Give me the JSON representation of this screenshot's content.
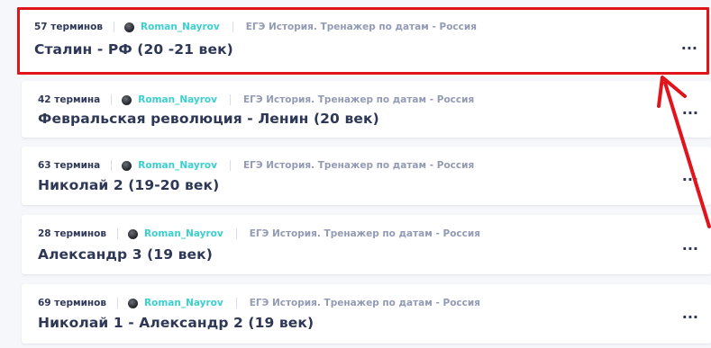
{
  "sets": [
    {
      "count": "57 терминов",
      "author": "Roman_Nayrov",
      "folder": "ЕГЭ История. Тренажер по датам - Россия",
      "title": "Сталин - РФ (20 -21 век)",
      "more": "..."
    },
    {
      "count": "42 термина",
      "author": "Roman_Nayrov",
      "folder": "ЕГЭ История. Тренажер по датам - Россия",
      "title": "Февральская революция - Ленин (20 век)",
      "more": "..."
    },
    {
      "count": "63 термина",
      "author": "Roman_Nayrov",
      "folder": "ЕГЭ История. Тренажер по датам - Россия",
      "title": "Николай 2 (19-20 век)",
      "more": "..."
    },
    {
      "count": "28 терминов",
      "author": "Roman_Nayrov",
      "folder": "ЕГЭ История. Тренажер по датам - Россия",
      "title": "Александр 3 (19 век)",
      "more": "..."
    },
    {
      "count": "69 терминов",
      "author": "Roman_Nayrov",
      "folder": "ЕГЭ История. Тренажер по датам - Россия",
      "title": "Николай 1 - Александр 2 (19 век)",
      "more": "..."
    }
  ],
  "colors": {
    "highlight": "#e2141b",
    "author": "#3ccfcf",
    "title": "#2e3856",
    "folder": "#939bb4"
  }
}
